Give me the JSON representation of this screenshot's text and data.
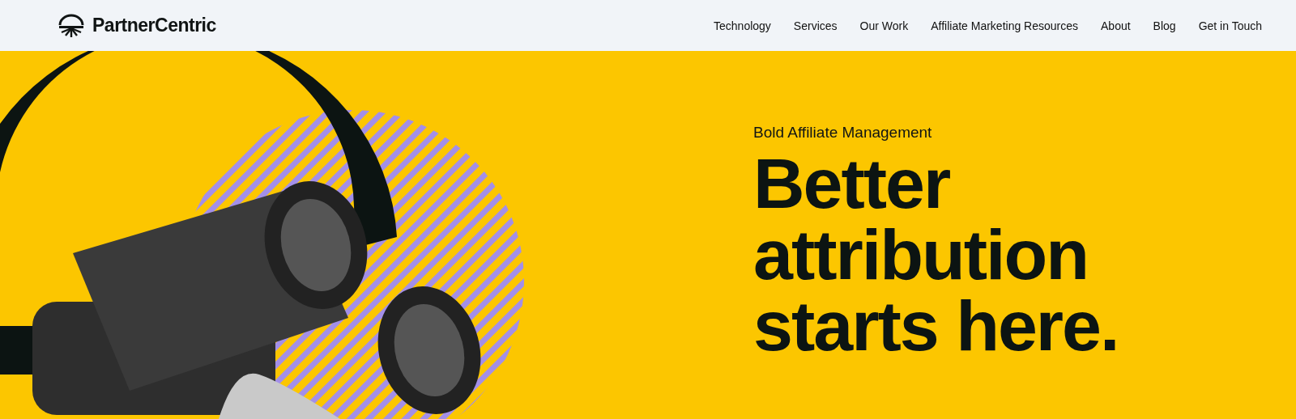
{
  "header": {
    "logo": {
      "text": "PartnerCentric"
    },
    "nav": [
      {
        "label": "Technology"
      },
      {
        "label": "Services"
      },
      {
        "label": "Our Work"
      },
      {
        "label": "Affiliate Marketing Resources"
      },
      {
        "label": "About"
      },
      {
        "label": "Blog"
      },
      {
        "label": "Get in Touch"
      }
    ]
  },
  "hero": {
    "eyebrow": "Bold Affiliate Management",
    "headline": [
      "Better",
      "attribution",
      "starts here."
    ]
  }
}
